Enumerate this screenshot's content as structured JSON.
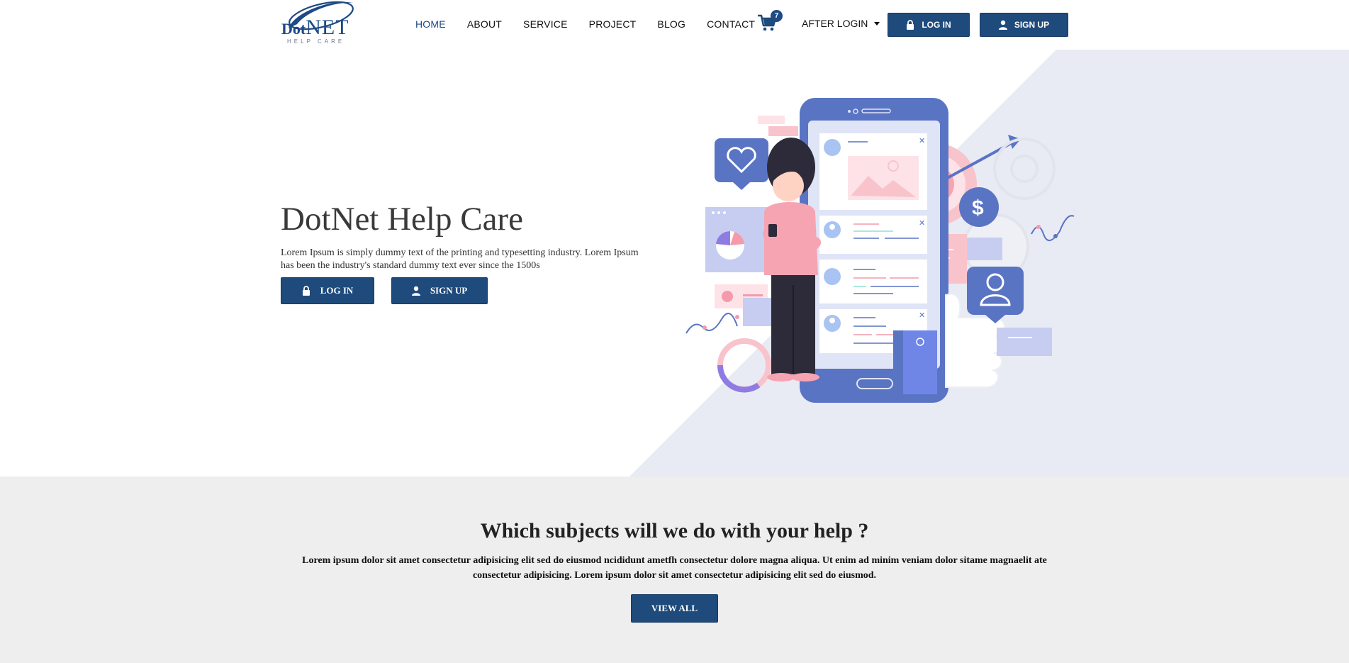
{
  "brand": {
    "logo_dot": "Dot",
    "logo_net": "NET",
    "logo_sub": "HELP CARE"
  },
  "nav": {
    "items": [
      {
        "label": "HOME",
        "active": true
      },
      {
        "label": "ABOUT",
        "active": false
      },
      {
        "label": "SERVICE",
        "active": false
      },
      {
        "label": "PROJECT",
        "active": false
      },
      {
        "label": "BLOG",
        "active": false
      },
      {
        "label": "CONTACT",
        "active": false
      }
    ],
    "cart_count": "7",
    "after_login_label": "AFTER LOGIN",
    "login_label": "LOG IN",
    "signup_label": "SIGN UP"
  },
  "hero": {
    "title": "DotNet Help Care",
    "text": "Lorem Ipsum is simply dummy text of the printing and typesetting industry. Lorem Ipsum has been the industry's standard dummy text ever since the 1500s",
    "login_label": "LOG IN",
    "signup_label": "SIGN UP"
  },
  "subjects": {
    "heading": "Which subjects will we do with your help ?",
    "text": "Lorem ipsum dolor sit amet consectetur adipisicing elit sed do eiusmod ncididunt ametfh consectetur dolore magna aliqua. Ut enim ad minim veniam dolor sitame magnaelit ate consectetur adipisicing. Lorem ipsum dolor sit amet consectetur adipisicing elit sed do eiusmod.",
    "button_label": "VIEW ALL"
  },
  "colors": {
    "primary": "#1e4a7c",
    "accent_blue": "#5a74c4",
    "accent_pink": "#f4b6c2",
    "hero_bg_shape": "#e8ebf3",
    "section_bg": "#eeeeee"
  }
}
